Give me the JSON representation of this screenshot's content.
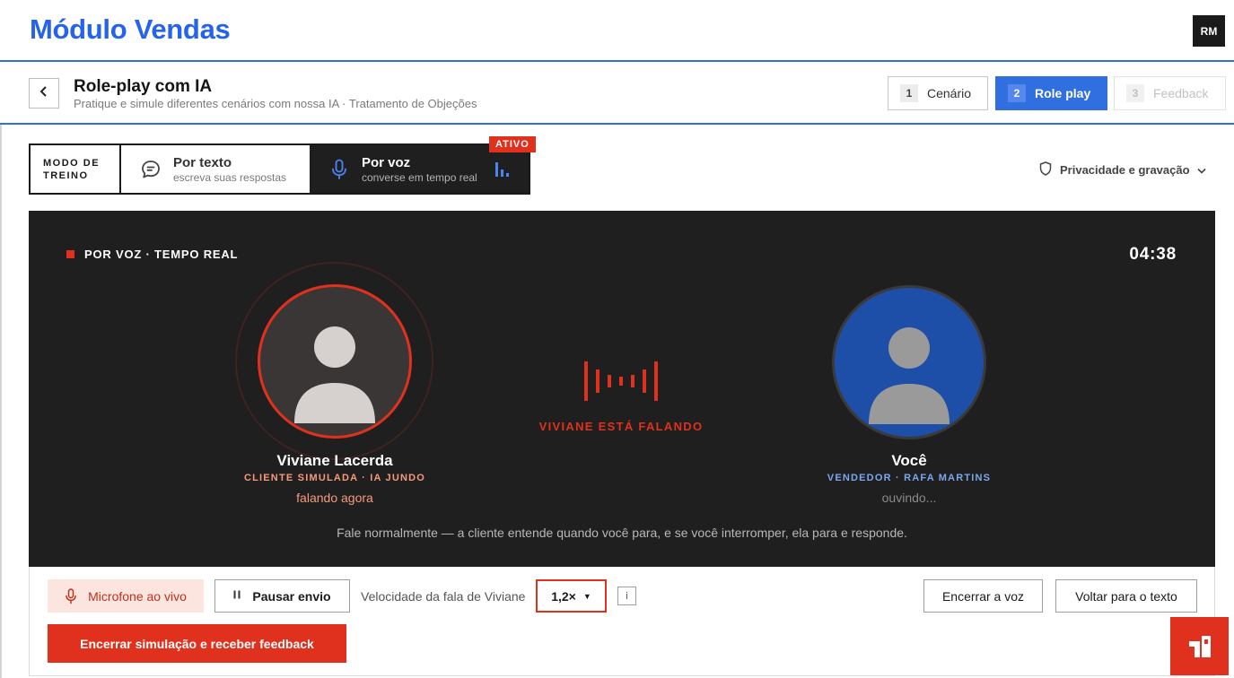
{
  "app": {
    "title": "Módulo Vendas",
    "user_initials": "RM"
  },
  "page": {
    "title": "Role-play com IA",
    "subtitle": "Pratique e simule diferentes cenários com nossa IA · Tratamento de Objeções"
  },
  "steps": [
    {
      "num": "1",
      "label": "Cenário",
      "state": "done"
    },
    {
      "num": "2",
      "label": "Role play",
      "state": "current"
    },
    {
      "num": "3",
      "label": "Feedback",
      "state": "disabled"
    }
  ],
  "mode": {
    "label": "MODO DE TREINO",
    "text_option": {
      "title": "Por texto",
      "subtitle": "escreva suas respostas"
    },
    "voice_option": {
      "title": "Por voz",
      "subtitle": "converse em tempo real"
    },
    "active_badge": "ATIVO"
  },
  "privacy_label": "Privacidade e gravação",
  "stage": {
    "tag": "POR VOZ · TEMPO REAL",
    "timer": "04:38",
    "ai": {
      "name": "Viviane Lacerda",
      "role": "CLIENTE SIMULADA · IA JUNDO",
      "state": "falando agora"
    },
    "user": {
      "name": "Você",
      "role": "VENDEDOR · RAFA MARTINS",
      "state": "ouvindo..."
    },
    "speaking_label": "VIVIANE ESTÁ FALANDO",
    "hint": "Fale normalmente — a cliente entende quando você para, e se você interromper, ela para e responde."
  },
  "controls": {
    "mic_label": "Microfone ao vivo",
    "pause_label": "Pausar envio",
    "speed_label": "Velocidade da fala de Viviane",
    "speed_value": "1,2×",
    "info_label": "i",
    "end_voice_label": "Encerrar a voz",
    "back_text_label": "Voltar para o texto",
    "end_sim_label": "Encerrar simulação e receber feedback"
  },
  "colors": {
    "brand_blue": "#2563eb",
    "accent_red": "#e0301e",
    "stage_bg": "#1f1f1f"
  },
  "icons": [
    "chevron-left-icon",
    "chat-bubble-icon",
    "microphone-icon",
    "audio-bars-icon",
    "shield-icon",
    "chevron-down-icon",
    "user-avatar-icon",
    "waveform-icon",
    "pause-icon",
    "caret-down-icon",
    "info-icon",
    "app-logo-icon"
  ]
}
